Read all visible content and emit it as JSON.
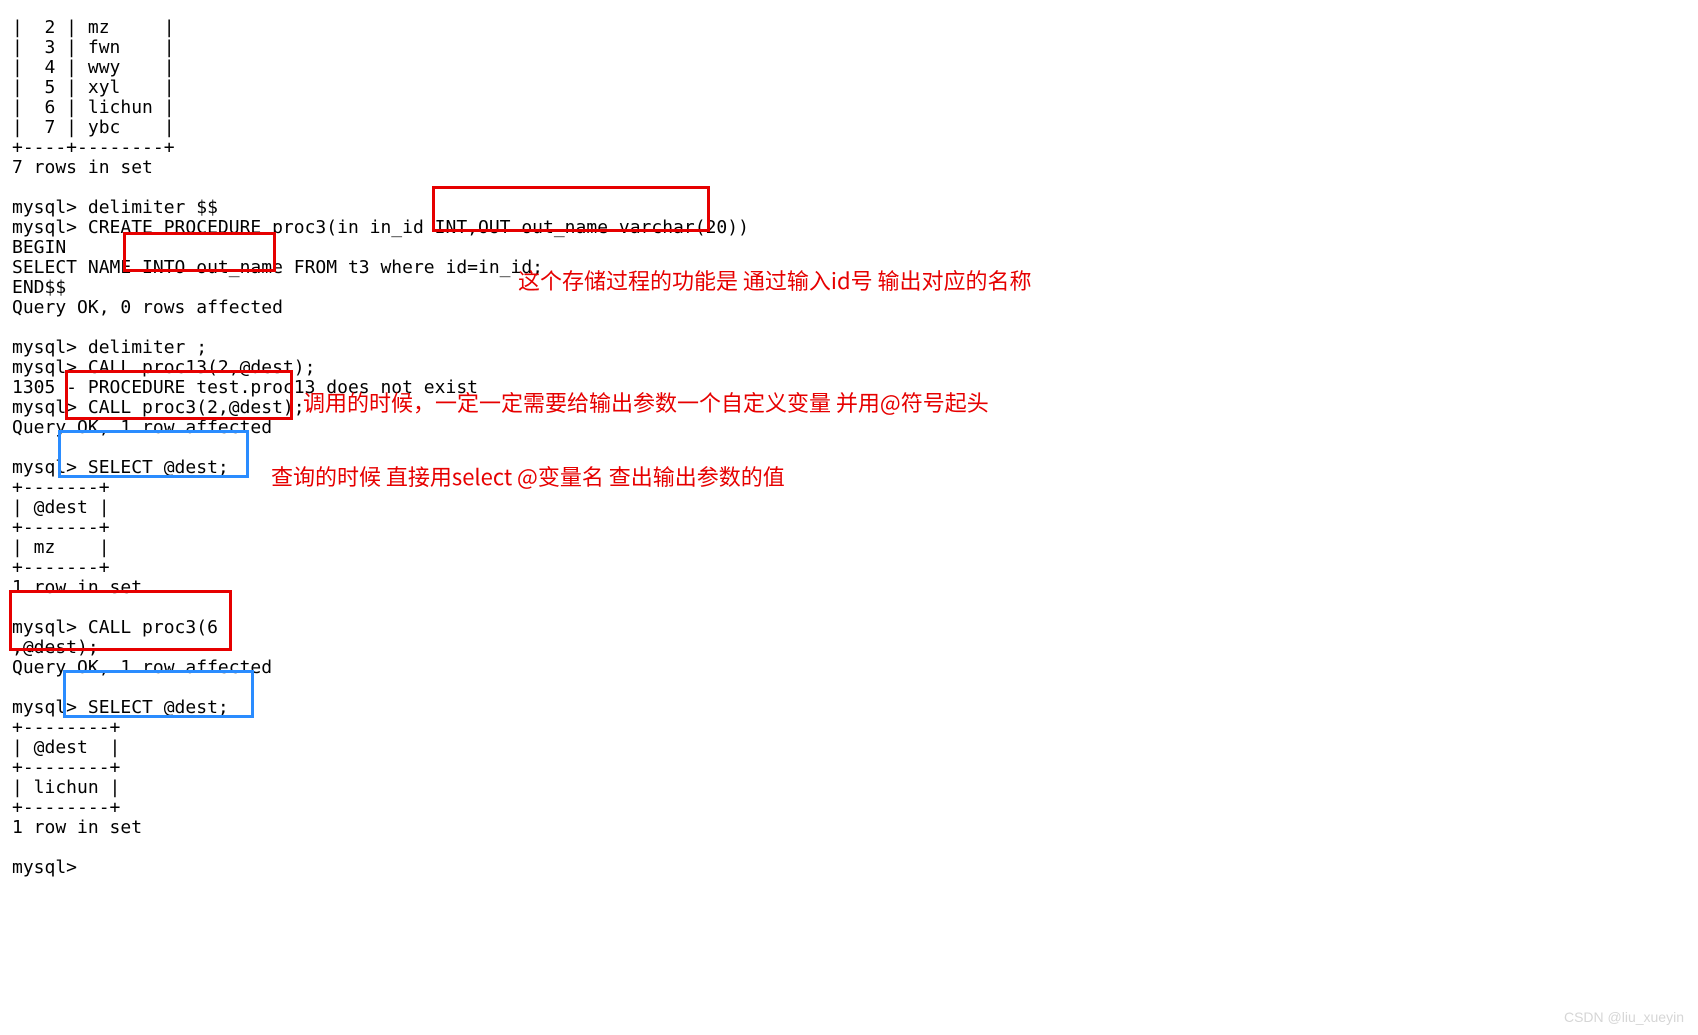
{
  "code": {
    "line01": "|  2 | mz     |",
    "line02": "|  3 | fwn    |",
    "line03": "|  4 | wwy    |",
    "line04": "|  5 | xyl    |",
    "line05": "|  6 | lichun |",
    "line06": "|  7 | ybc    |",
    "line07": "+----+--------+",
    "line08": "7 rows in set",
    "line09": "",
    "line10": "mysql> delimiter $$",
    "line11": "mysql> CREATE PROCEDURE proc3(in in_id INT,OUT out_name varchar(20))",
    "line12": "BEGIN",
    "line13": "SELECT NAME INTO out_name FROM t3 where id=in_id;",
    "line14": "END$$",
    "line15": "Query OK, 0 rows affected",
    "line16": "",
    "line17": "mysql> delimiter ;",
    "line18": "mysql> CALL proc13(2,@dest);",
    "line19": "1305 - PROCEDURE test.proc13 does not exist",
    "line20": "mysql> CALL proc3(2,@dest);",
    "line21": "Query OK, 1 row affected",
    "line22": "",
    "line23": "mysql> SELECT @dest;",
    "line24": "+-------+",
    "line25": "| @dest |",
    "line26": "+-------+",
    "line27": "| mz    |",
    "line28": "+-------+",
    "line29": "1 row in set",
    "line30": "",
    "line31": "mysql> CALL proc3(6",
    "line32": ",@dest);",
    "line33": "Query OK, 1 row affected",
    "line34": "",
    "line35": "mysql> SELECT @dest;",
    "line36": "+--------+",
    "line37": "| @dest  |",
    "line38": "+--------+",
    "line39": "| lichun |",
    "line40": "+--------+",
    "line41": "1 row in set",
    "line42": "",
    "line43": "mysql>"
  },
  "annotations": {
    "a1": "这个存储过程的功能是 通过输入id号 输出对应的名称",
    "a2": "调用的时候，一定一定需要给输出参数一个自定义变量 并用@符号起头",
    "a3": "查询的时候 直接用select @变量名 查出输出参数的值"
  },
  "watermark": "CSDN @liu_xueyin"
}
